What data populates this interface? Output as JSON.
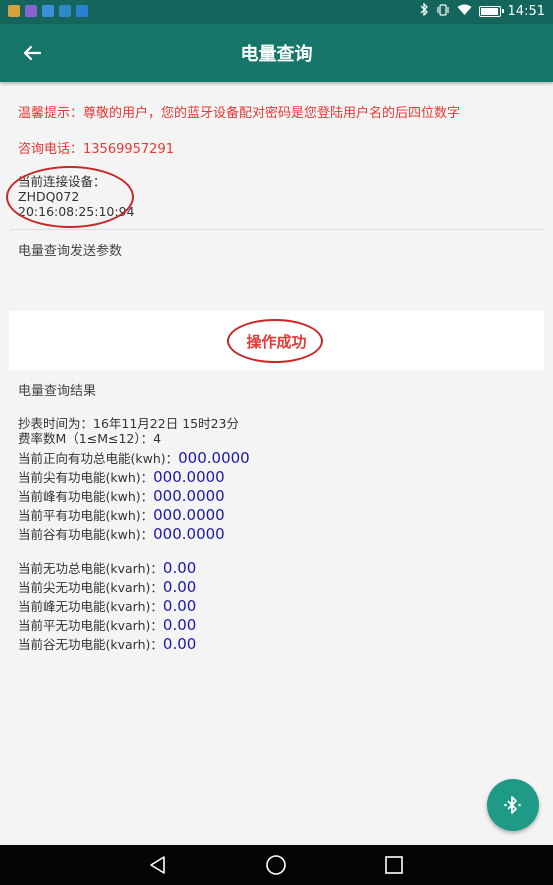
{
  "status_bar": {
    "time": "14:51",
    "icons": [
      "bluetooth-icon",
      "vibrate-icon",
      "wifi-icon",
      "battery-icon"
    ],
    "battery_level": 0.85,
    "notification_colors": [
      "#d9a23b",
      "#8a63d2",
      "#3a8fd8",
      "#2e89c9",
      "#2a7fd6"
    ]
  },
  "app_bar": {
    "title": "电量查询",
    "back_icon": "arrow-back-icon"
  },
  "tip": "温馨提示：尊敬的用户，您的蓝牙设备配对密码是您登陆用户名的后四位数字",
  "phone": "咨询电话：13569957291",
  "device": {
    "label": "当前连接设备：",
    "name": "ZHDQ072",
    "address": "20:16:08:25:10:94"
  },
  "param_label": "电量查询发送参数",
  "result_status": "操作成功",
  "results_title": "电量查询结果",
  "meter_time": "抄表时间为：16年11月22日 15时23分",
  "rate_count": "费率数M（1≤M≤12）：4",
  "active_energy": [
    {
      "label": "当前正向有功总电能(kwh)：",
      "value": "000.0000"
    },
    {
      "label": "当前尖有功电能(kwh)：",
      "value": "000.0000"
    },
    {
      "label": "当前峰有功电能(kwh)：",
      "value": "000.0000"
    },
    {
      "label": "当前平有功电能(kwh)：",
      "value": "000.0000"
    },
    {
      "label": "当前谷有功电能(kwh)：",
      "value": "000.0000"
    }
  ],
  "reactive_energy": [
    {
      "label": "当前无功总电能(kvarh)：",
      "value": "0.00"
    },
    {
      "label": "当前尖无功电能(kvarh)：",
      "value": "0.00"
    },
    {
      "label": "当前峰无功电能(kvarh)：",
      "value": "0.00"
    },
    {
      "label": "当前平无功电能(kvarh)：",
      "value": "0.00"
    },
    {
      "label": "当前谷无功电能(kvarh)：",
      "value": "0.00"
    }
  ],
  "fab_icon": "bluetooth-search-icon",
  "nav": [
    "back-triangle-icon",
    "home-circle-icon",
    "recents-square-icon"
  ],
  "colors": {
    "status_bar": "#14655b",
    "app_bar": "#17766a",
    "accent_red": "#e53935",
    "value_blue": "#1a1aa8",
    "fab": "#1e9a86"
  }
}
